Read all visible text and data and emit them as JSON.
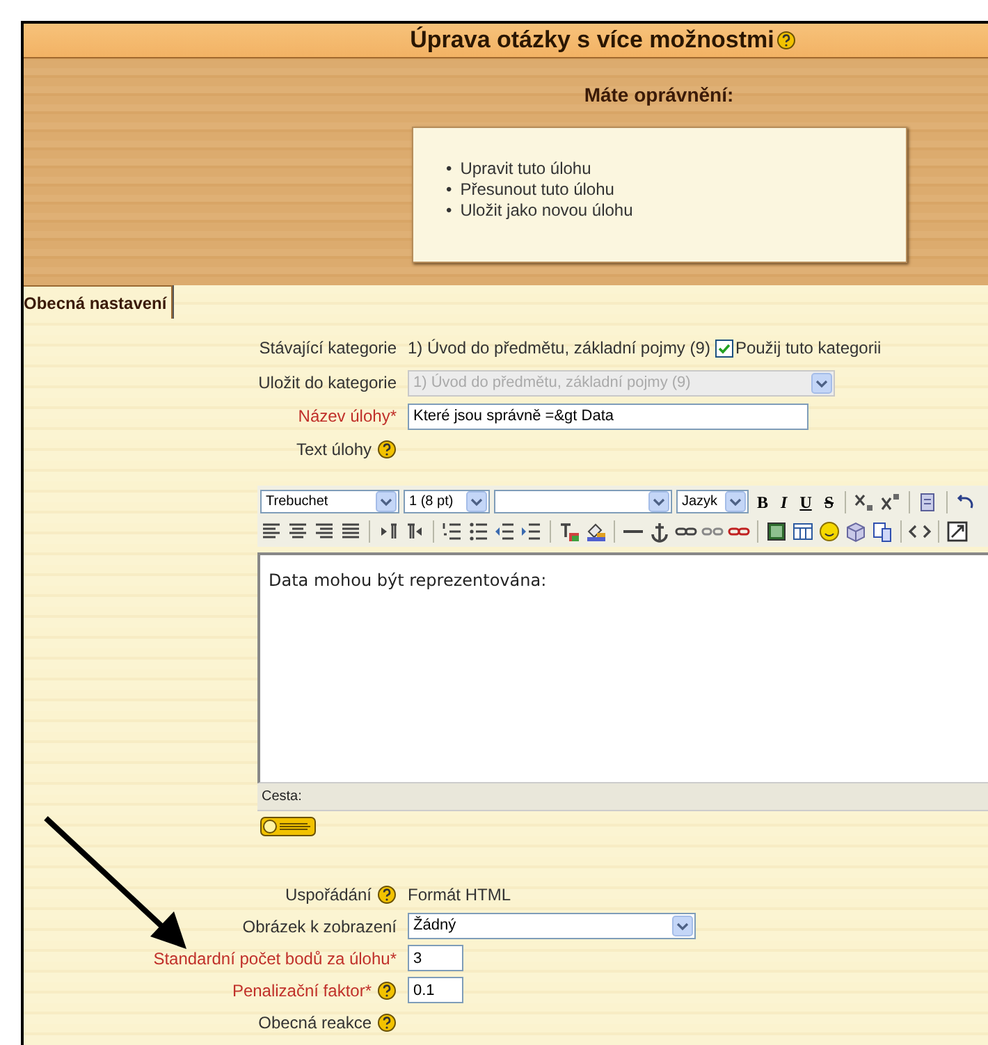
{
  "title": "Úprava otázky s více možnostmi",
  "permissions": {
    "heading": "Máte oprávnění:",
    "items": [
      {
        "marker": "•",
        "text": "Upravit tuto úlohu"
      },
      {
        "marker": "•",
        "text": "Přesunout tuto úlohu"
      },
      {
        "marker": "•",
        "text": "Uložit jako novou úlohu"
      }
    ]
  },
  "section_tab": "Obecná nastavení",
  "fields": [
    {
      "kind": "static",
      "label": "Stávající kategorie",
      "value": "1) Úvod do předmětu, základní pojmy (9)",
      "checkbox": {
        "label": "Použij tuto kategorii",
        "checked": true
      }
    },
    {
      "kind": "select",
      "label": "Uložit do kategorie",
      "value": "1) Úvod do předmětu, základní pojmy (9)",
      "disabled": true
    },
    {
      "kind": "text",
      "label": "Název úlohy*",
      "required": true,
      "value": "Které jsou správně =&gt Data"
    },
    {
      "kind": "heading",
      "label": "Text úlohy",
      "help": true
    }
  ],
  "editor": {
    "font": "Trebuchet",
    "size": "1 (8 pt)",
    "language": "Jazyk",
    "format_buttons": [
      "B",
      "I",
      "U",
      "S"
    ],
    "content": "Data mohou být reprezentována:",
    "path_label": "Cesta:"
  },
  "fields2": [
    {
      "kind": "static",
      "label": "Uspořádání",
      "help": true,
      "value": "Formát HTML"
    },
    {
      "kind": "select",
      "label": "Obrázek k zobrazení",
      "value": "Žádný",
      "disabled": false
    },
    {
      "kind": "text",
      "label": "Standardní počet bodů za úlohu*",
      "required": true,
      "value": "3"
    },
    {
      "kind": "text",
      "label": "Penalizační faktor*",
      "required": true,
      "help": true,
      "value": "0.1"
    },
    {
      "kind": "heading",
      "label": "Obecná reakce",
      "help": true
    }
  ]
}
